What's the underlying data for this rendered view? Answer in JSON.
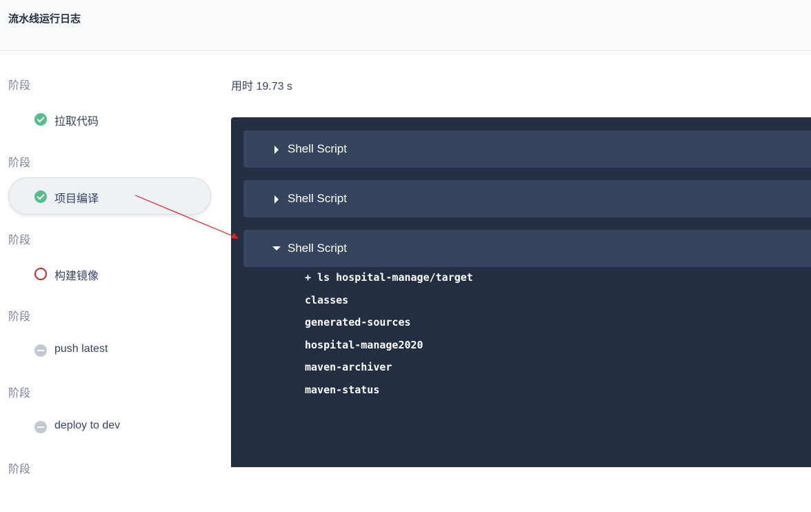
{
  "header": {
    "title": "流水线运行日志"
  },
  "sidebar": {
    "stages": [
      {
        "label": "阶段",
        "step": "拉取代码",
        "status": "success"
      },
      {
        "label": "阶段",
        "step": "项目编译",
        "status": "success",
        "active": true
      },
      {
        "label": "阶段",
        "step": "构建镜像",
        "status": "failed"
      },
      {
        "label": "阶段",
        "step": "push latest",
        "status": "pending"
      },
      {
        "label": "阶段",
        "step": "deploy to dev",
        "status": "pending"
      },
      {
        "label": "阶段"
      }
    ]
  },
  "main": {
    "duration": "用时 19.73 s",
    "scripts": [
      {
        "title": "Shell Script",
        "expanded": false
      },
      {
        "title": "Shell Script",
        "expanded": false
      },
      {
        "title": "Shell Script",
        "expanded": true
      }
    ],
    "log_lines": [
      "+ ls hospital-manage/target",
      "classes",
      "generated-sources",
      "hospital-manage2020",
      "maven-archiver",
      "maven-status"
    ]
  },
  "colors": {
    "success": "#55bc8a",
    "failed": "#ca2621",
    "pending": "#c1c9d1",
    "log_background": "#242e42",
    "script_header": "#36435c",
    "annotation_arrow": "#e02020"
  }
}
